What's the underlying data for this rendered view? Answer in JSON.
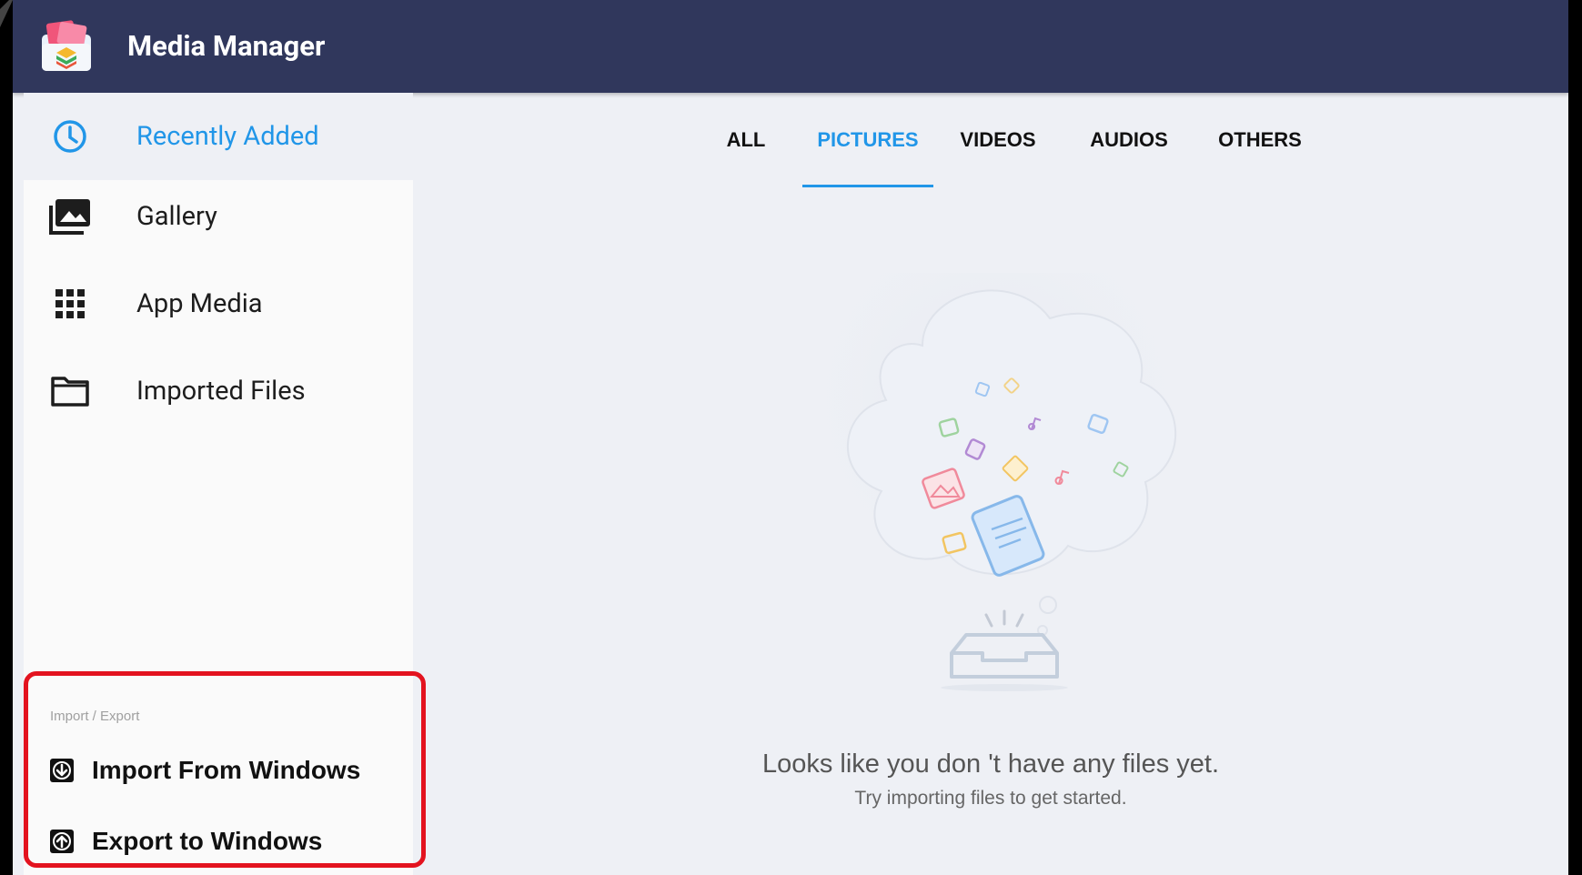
{
  "header": {
    "title": "Media Manager"
  },
  "sidebar": {
    "items": [
      {
        "label": "Recently Added",
        "icon": "clock-icon",
        "active": true
      },
      {
        "label": "Gallery",
        "icon": "gallery-icon",
        "active": false
      },
      {
        "label": "App Media",
        "icon": "grid-icon",
        "active": false
      },
      {
        "label": "Imported Files",
        "icon": "folder-icon",
        "active": false
      }
    ],
    "import_export": {
      "heading": "Import / Export",
      "import_label": "Import From Windows",
      "export_label": "Export to Windows"
    }
  },
  "tabs": [
    {
      "label": "ALL",
      "active": false
    },
    {
      "label": "PICTURES",
      "active": true
    },
    {
      "label": "VIDEOS",
      "active": false
    },
    {
      "label": "AUDIOS",
      "active": false
    },
    {
      "label": "OTHERS",
      "active": false
    }
  ],
  "empty_state": {
    "title": "Looks like you don 't have any files yet.",
    "subtitle": "Try importing files to get started."
  },
  "colors": {
    "header_bg": "#30375c",
    "accent": "#2196e8",
    "highlight_border": "#e3131f"
  }
}
